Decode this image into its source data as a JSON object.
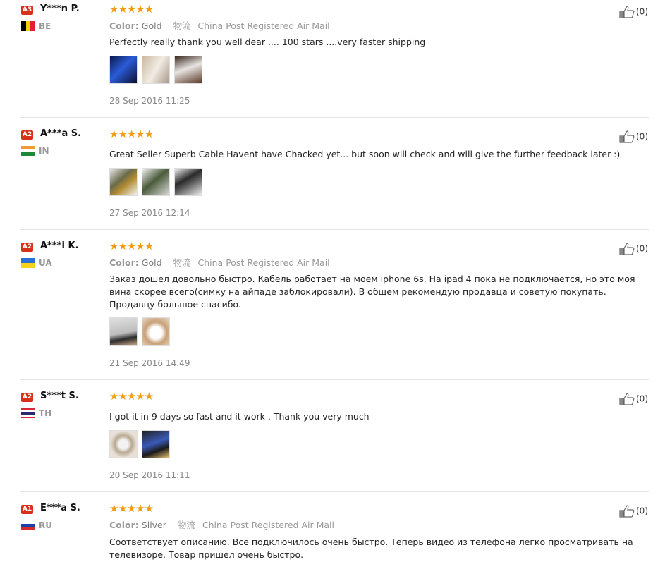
{
  "labels": {
    "color_prefix": "Color:",
    "logistics_cn": "物流",
    "helpful_icon": "thumbs-up-icon"
  },
  "colors": {
    "badge": "#d9301c",
    "star": "#f39c12",
    "divider": "#e4e4e4"
  },
  "reviews": [
    {
      "level": "A3",
      "buyer": "Y***n P.",
      "country": "BE",
      "stars": "★★★★★",
      "rating": 5,
      "color": "Gold",
      "shipping": "China Post Registered Air Mail",
      "feedback": "Perfectly really thank you well dear .... 100 stars ....very faster shipping",
      "photos": 3,
      "date": "28 Sep 2016 11:25",
      "helpful": "(0)"
    },
    {
      "level": "A2",
      "buyer": "A***a S.",
      "country": "IN",
      "stars": "★★★★★",
      "rating": 5,
      "color": "",
      "shipping": "",
      "feedback": "Great Seller Superb Cable Havent have Chacked yet... but soon will check and will give the further feedback later :)",
      "photos": 3,
      "date": "27 Sep 2016 12:14",
      "helpful": "(0)"
    },
    {
      "level": "A2",
      "buyer": "A***i K.",
      "country": "UA",
      "stars": "★★★★★",
      "rating": 5,
      "color": "Gold",
      "shipping": "China Post Registered Air Mail",
      "feedback": "Заказ дошел довольно быстро. Кабель работает на моем iphone 6s. На ipad 4 пока не подключается, но это моя вина скорее всего(симку на айпаде заблокировали). В общем рекомендую продавца и советую покупать. Продавцу большое спасибо.",
      "photos": 2,
      "date": "21 Sep 2016 14:49",
      "helpful": "(0)"
    },
    {
      "level": "A2",
      "buyer": "S***t S.",
      "country": "TH",
      "stars": "★★★★★",
      "rating": 5,
      "color": "",
      "shipping": "",
      "feedback": "I got it in 9 days so fast and it work , Thank you very much",
      "photos": 2,
      "date": "20 Sep 2016 11:11",
      "helpful": "(0)"
    },
    {
      "level": "A1",
      "buyer": "E***a S.",
      "country": "RU",
      "stars": "★★★★★",
      "rating": 5,
      "color": "Silver",
      "shipping": "China Post Registered Air Mail",
      "feedback": "Соответствует описанию. Все подключилось очень быстро. Теперь видео из телефона легко просматривать на телевизоре. Товар пришел очень быстро.",
      "photos": 0,
      "date": "",
      "helpful": "(0)"
    }
  ]
}
